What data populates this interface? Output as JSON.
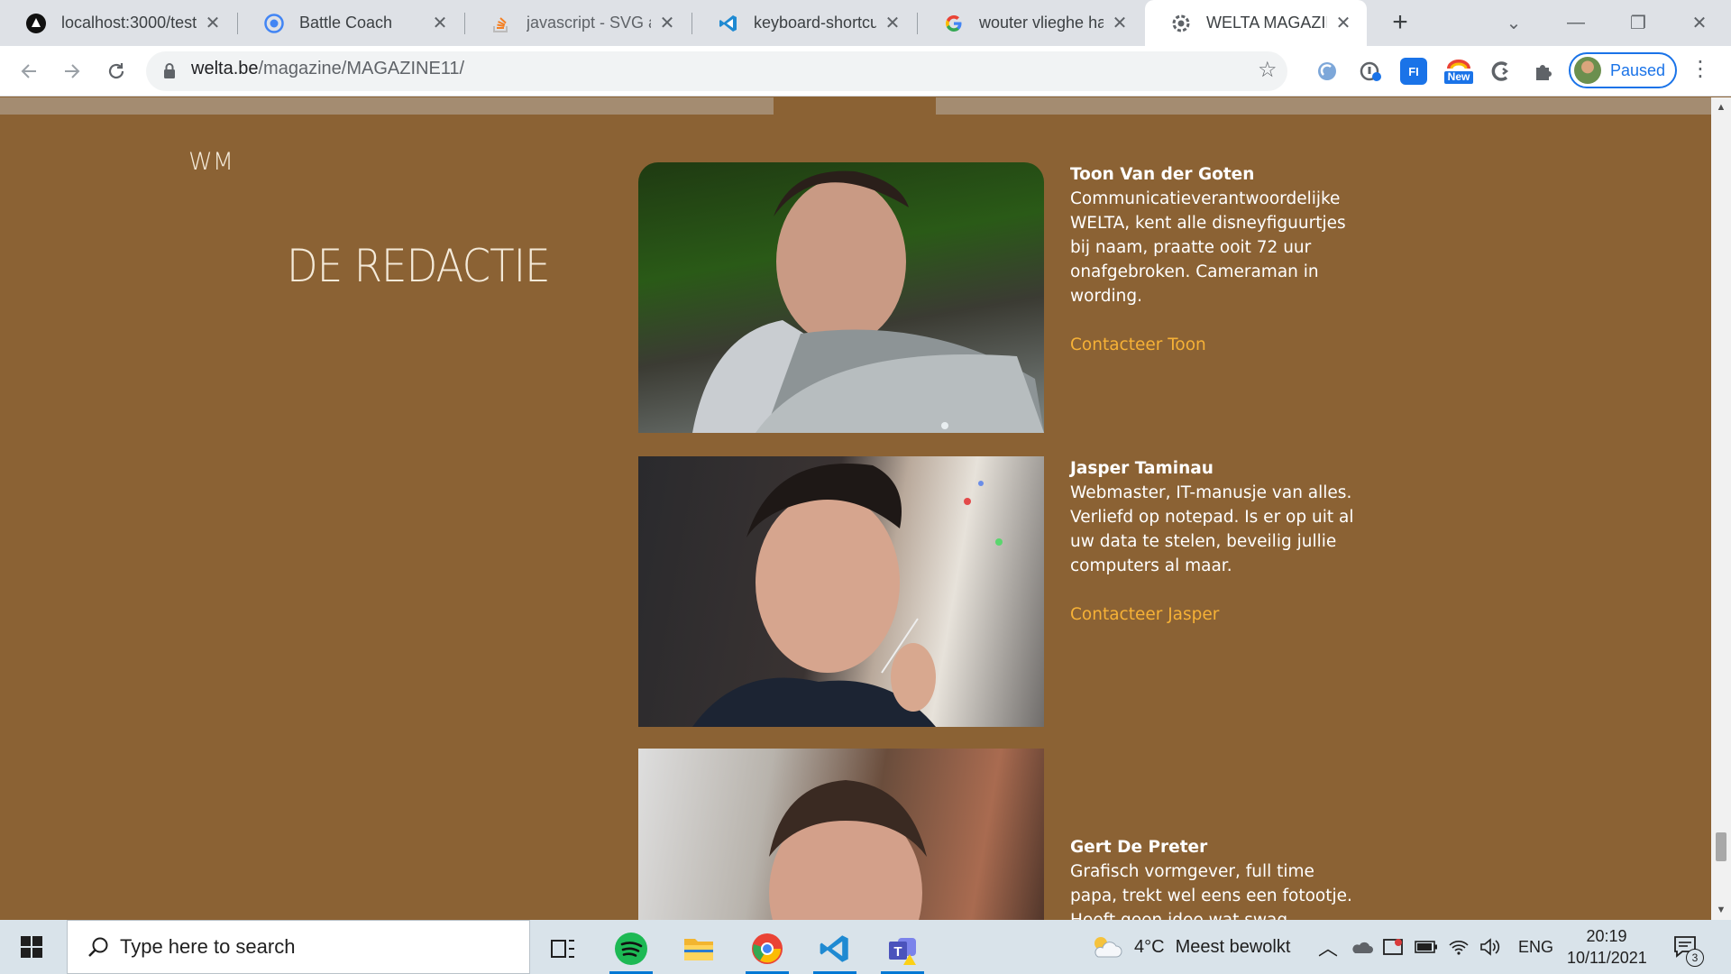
{
  "browser": {
    "tabs": [
      {
        "title": "localhost:3000/test",
        "icon": "app-triangle-icon"
      },
      {
        "title": "Battle Coach",
        "icon": "target-icon"
      },
      {
        "title": "javascript - SVG arc",
        "icon": "stackoverflow-icon"
      },
      {
        "title": "keyboard-shortcuts",
        "icon": "vscode-icon"
      },
      {
        "title": "wouter vlieghe han",
        "icon": "google-icon"
      },
      {
        "title": "WELTA MAGAZINE",
        "icon": "gear-globe-icon",
        "active": true
      }
    ],
    "url_host": "welta.be",
    "url_path": "/magazine/MAGAZINE11/",
    "extension_badge": "New",
    "profile_label": "Paused",
    "accent": "#1a73e8"
  },
  "page": {
    "logo": "WM",
    "heading": "DE REDACTIE",
    "background": "#8b6234",
    "link_color": "#f6b136",
    "members": [
      {
        "name": "Toon Van der Goten",
        "bio": "Communicatieverantwoordelijke WELTA, kent alle disneyfiguurtjes bij naam, praatte ooit 72 uur onafgebroken. Cameraman in wording.",
        "contact": "Contacteer Toon"
      },
      {
        "name": "Jasper Taminau",
        "bio": "Webmaster, IT-manusje van alles. Verliefd op notepad. Is er op uit al uw data te stelen, beveilig jullie computers al maar.",
        "contact": "Contacteer Jasper"
      },
      {
        "name": "Gert De Preter",
        "bio": "Grafisch vormgever, full time papa, trekt wel eens een fotootje. Heeft geen idee wat swag",
        "contact": ""
      }
    ]
  },
  "taskbar": {
    "search_placeholder": "Type here to search",
    "weather_temp": "4°C",
    "weather_text": "Meest bewolkt",
    "language": "ENG",
    "time": "20:19",
    "date": "10/11/2021",
    "notifications": "3"
  }
}
